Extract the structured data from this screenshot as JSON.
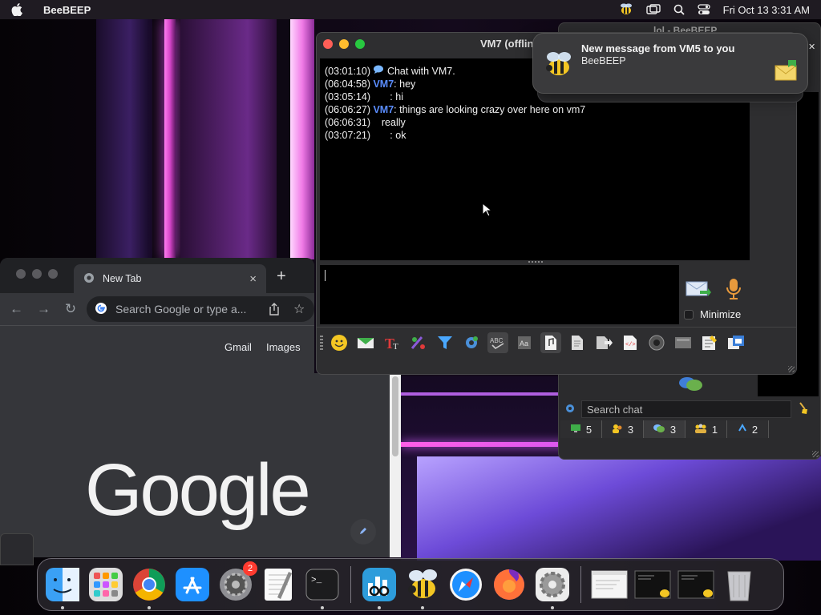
{
  "menubar": {
    "app_name": "BeeBEEP",
    "clock": "Fri Oct 13  3:31 AM"
  },
  "chrome": {
    "tab_title": "New Tab",
    "tab_close": "×",
    "new_tab": "+",
    "omnibox_placeholder": "Search Google or type a...",
    "links": {
      "gmail": "Gmail",
      "images": "Images"
    },
    "logo_text": "Google"
  },
  "bee_main": {
    "title": "lol - BeeBEEP",
    "search_placeholder": "Search chat",
    "tabs": [
      {
        "icon": "computer-icon",
        "count": "5"
      },
      {
        "icon": "users-icon",
        "count": "3"
      },
      {
        "icon": "chats-icon",
        "count": "3"
      },
      {
        "icon": "groups-icon",
        "count": "1"
      },
      {
        "icon": "files-icon",
        "count": "2"
      }
    ]
  },
  "chat": {
    "title": "VM7 (offline)",
    "messages": [
      {
        "time": "(03:01:10)",
        "nick": "",
        "text": " Chat with VM7."
      },
      {
        "time": "(06:04:58)",
        "nick": "VM7",
        "text": ": hey"
      },
      {
        "time": "(03:05:14)",
        "nick": "",
        "text": "       : hi"
      },
      {
        "time": "(06:06:27)",
        "nick": "VM7",
        "text": ": things are looking crazy over here on vm7"
      },
      {
        "time": "(06:06:31)",
        "nick": "",
        "text": "    really"
      },
      {
        "time": "(03:07:21)",
        "nick": "",
        "text": "       : ok"
      }
    ],
    "minimize_label": "Minimize",
    "tools": [
      "smiley-icon",
      "mail-icon",
      "font-icon",
      "color-icon",
      "filter-icon",
      "gear-icon",
      "spellcheck-icon",
      "dictionary-icon",
      "file-icon",
      "folder-icon",
      "share-icon",
      "html-icon",
      "screenshot-icon",
      "keyboard-icon",
      "notes-icon",
      "window-icon"
    ],
    "colors": {
      "nick": "#5a8dff",
      "history_bg": "#000000"
    }
  },
  "notification": {
    "title": "New message from VM5 to you",
    "body": "BeeBEEP"
  },
  "dock": {
    "apps": [
      "finder-icon",
      "launchpad-icon",
      "chrome-icon",
      "app-store-icon",
      "system-settings-icon",
      "textedit-icon",
      "terminal-icon",
      "istat-icon",
      "beebeep-icon",
      "safari-icon",
      "firefox-icon",
      "preferences-icon"
    ],
    "settings_badge": "2"
  }
}
